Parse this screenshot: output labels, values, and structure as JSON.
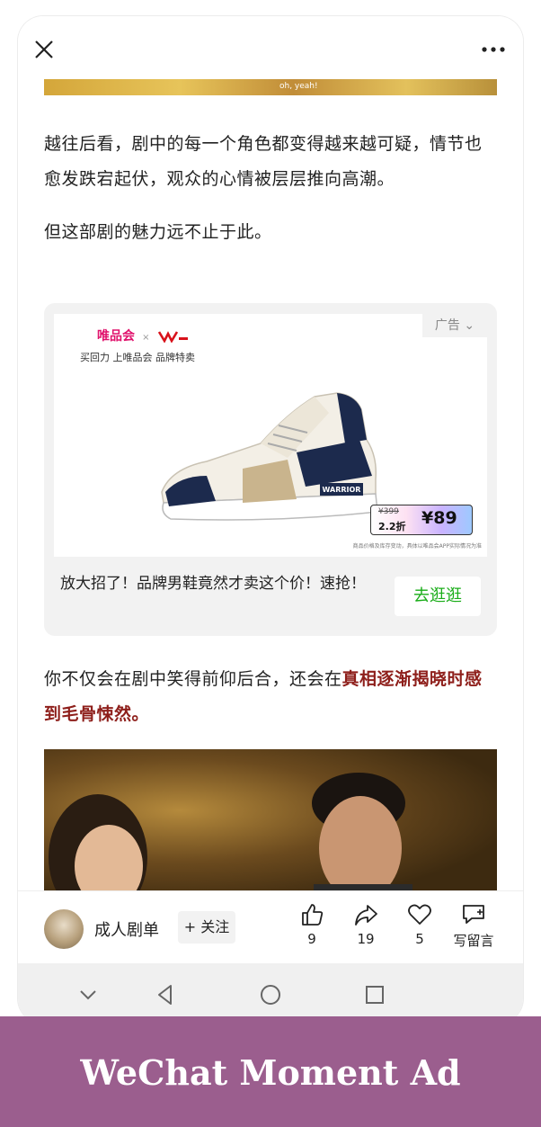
{
  "top_image": {
    "caption": "oh, yeah!"
  },
  "article": {
    "p1": "越往后看，剧中的每一个角色都变得越来越可疑，情节也愈发跌宕起伏，观众的心情被层层推向高潮。",
    "p2": "但这部剧的魅力远不止于此。",
    "p3_plain": "你不仅会在剧中笑得前仰后合，还会在",
    "p3_emph": "真相逐渐揭晓时感到毛骨悚然。"
  },
  "ad": {
    "tag": "广告",
    "brand": "唯品会",
    "brand_x": "×",
    "slogan": "买回力 上唯品会 品牌特卖",
    "shoe_label": "WARRIOR",
    "price_old": "¥399",
    "price_discount": "2.2折",
    "price_new": "¥89",
    "footnote": "商品价格及库存变动，具体以唯品会APP实际情况为准",
    "caption": "放大招了！品牌男鞋竟然才卖这个价！速抢！",
    "cta": "去逛逛"
  },
  "author": {
    "name": "成人剧单",
    "follow": "+ 关注"
  },
  "actions": {
    "like_count": "9",
    "share_count": "19",
    "wow_count": "5",
    "comment_label": "写留言"
  },
  "banner": {
    "text": "WeChat Moment Ad"
  },
  "colors": {
    "emphasis": "#8e1f1b",
    "cta_green": "#1aad19",
    "brand_pink": "#e0126c",
    "banner": "#9b5e8e"
  }
}
